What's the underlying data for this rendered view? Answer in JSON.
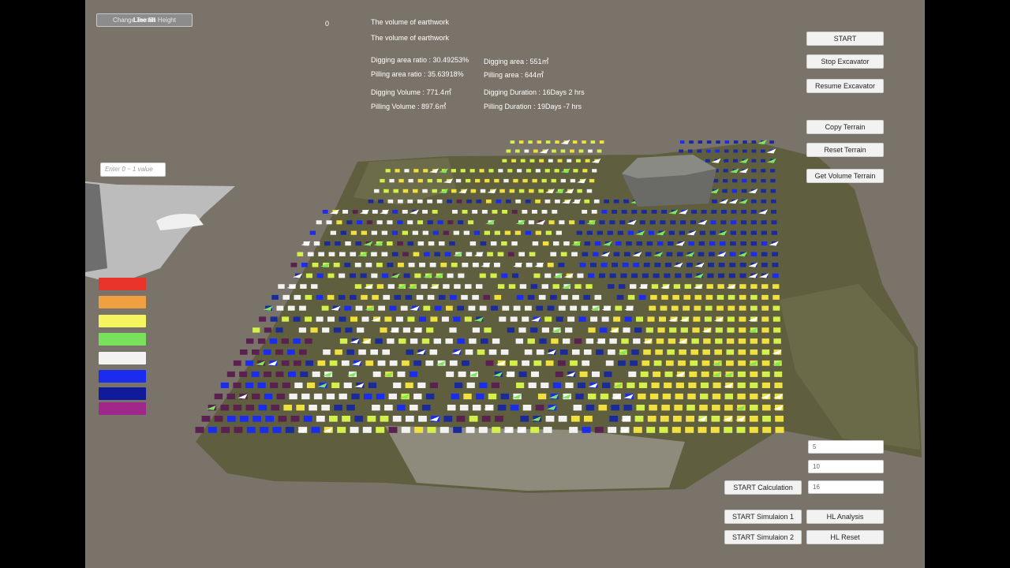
{
  "top_button": {
    "label_under": "Change Terrain Height",
    "label_over": "Line fill"
  },
  "counter": "0",
  "stats": {
    "title1": "The volume of earthwork",
    "title2": "The volume of earthwork",
    "digging_ratio": "Digging area ratio : 30.49253%",
    "pilling_ratio": "Pilling area ratio : 35.63918%",
    "digging_volume": "Digging Volume : 771.4㎥",
    "pilling_volume": "Pilling Volume : 897.6㎥",
    "digging_area": "Digging area : 551㎡",
    "pilling_area": "Pilling area : 644㎡",
    "digging_duration": "Digging Duration : 16Days 2 hrs",
    "pilling_duration": "Pilling Duration : 19Days -7 hrs"
  },
  "value_input": {
    "placeholder": "Enter 0 ~ 1 value"
  },
  "controls": {
    "start": "START",
    "stop": "Stop Excavator",
    "resume": "Resume Excavator",
    "copy": "Copy Terrain",
    "reset": "Reset Terrain",
    "get_volume": "Get Volume Terrain"
  },
  "calc": {
    "field1": "5",
    "field2": "10",
    "field3": "16",
    "start_calc": "START Calculation",
    "sim1": "START Simulaion 1",
    "sim2": "START Simulaion 2",
    "hl_analysis": "HL Analysis",
    "hl_reset": "HL Reset"
  },
  "legend_colors": [
    "#e8342a",
    "#f0a040",
    "#f5f560",
    "#78e05a",
    "#f2f2f2",
    "#1a2cf0",
    "#101a9a",
    "#a0288a"
  ]
}
